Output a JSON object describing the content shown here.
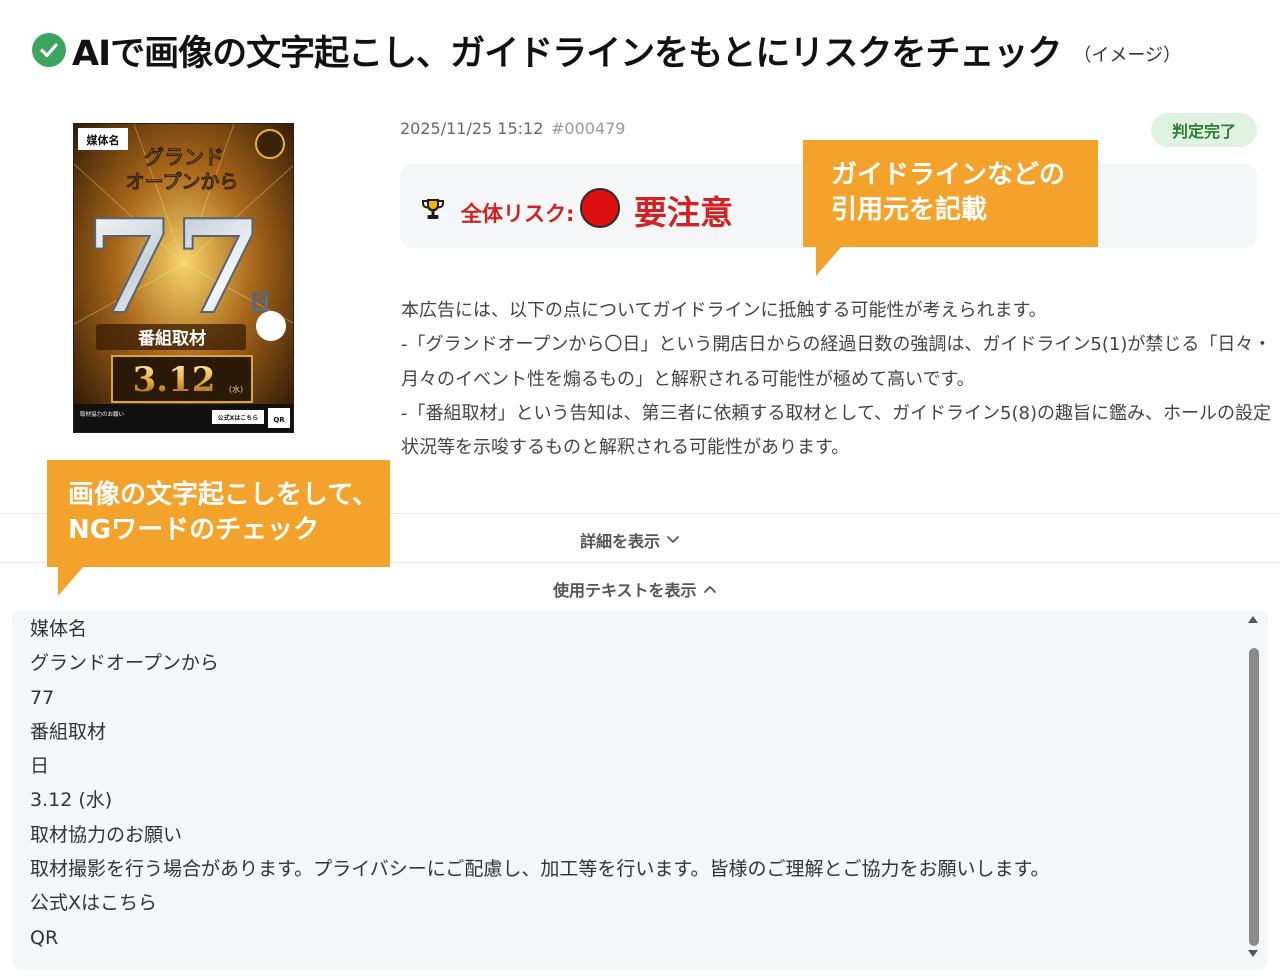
{
  "page": {
    "title": "AIで画像の文字起こし、ガイドラインをもとにリスクをチェック",
    "subtitle": "（イメージ）"
  },
  "card": {
    "date": "2025/11/25 15:12",
    "id": "#000479",
    "status": "判定完了",
    "risk_label": "全体リスク:",
    "risk_value": "要注意",
    "risk_color": "#e01010"
  },
  "explanation": {
    "lines": [
      "本広告には、以下の点についてガイドラインに抵触する可能性が考えられます。",
      "-「グランドオープンから〇日」という開店日からの経過日数の強調は、ガイドライン5(1)が禁じる「日々・",
      "月々のイベント性を煽るもの」と解釈される可能性が極めて高いです。",
      "-「番組取材」という告知は、第三者に依頼する取材として、ガイドライン5(8)の趣旨に鑑み、ホールの設定",
      "状況等を示唆するものと解釈される可能性があります。"
    ]
  },
  "callouts": {
    "guide_line1": "ガイドラインなどの",
    "guide_line2": "引用元を記載",
    "ocr_line1": "画像の文字起こしをして、",
    "ocr_line2": "NGワードのチェック"
  },
  "toggles": {
    "details": "詳細を表示",
    "used_text": "使用テキストを表示"
  },
  "ad": {
    "media": "媒体名",
    "headline": "グランドオープンから",
    "number": "77",
    "day": "日",
    "program": "番組取材",
    "date": "3.12",
    "weekday": "(水)",
    "request": "取材協力のお願い",
    "x_link": "公式Xはこちら",
    "qr": "QR"
  },
  "ocr_text": {
    "lines": [
      "媒体名",
      "グランドオープンから",
      "77",
      "番組取材",
      "日",
      "3.12 (水)",
      "取材協力のお願い",
      "取材撮影を行う場合があります。プライバシーにご配慮し、加工等を行います。皆様のご理解とご協力をお願いします。",
      "公式Xはこちら",
      "QR"
    ]
  },
  "colors": {
    "callout": "#f3a32c",
    "risk_red": "#d32020",
    "status_green": "#2e7d32",
    "check_green": "#3ba55d"
  }
}
